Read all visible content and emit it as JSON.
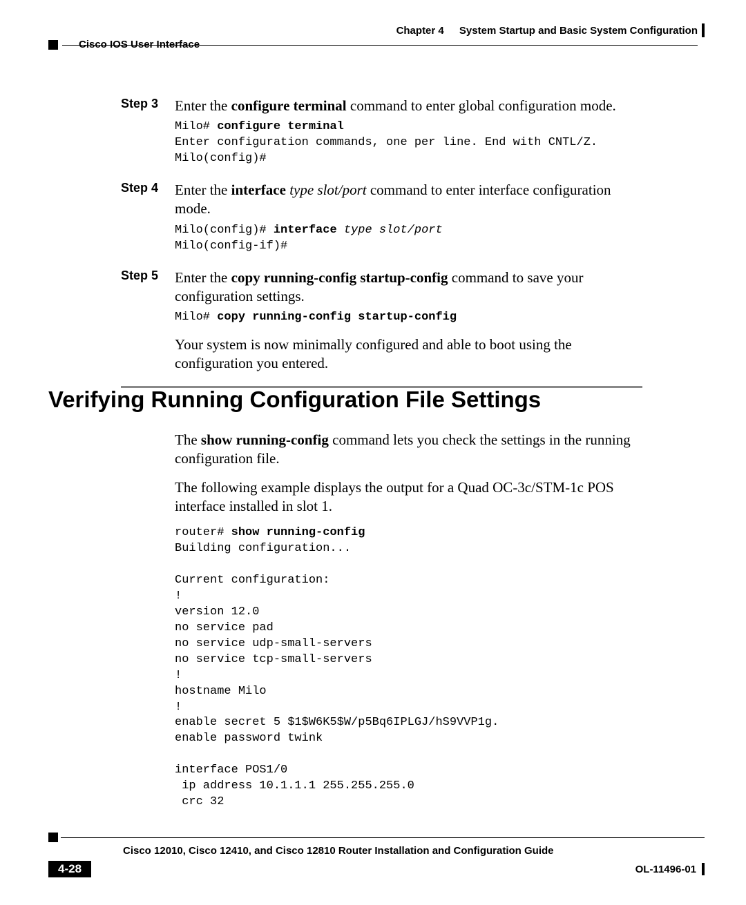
{
  "header": {
    "chapter_label": "Chapter 4",
    "chapter_title": "System Startup and Basic System Configuration",
    "subheader": "Cisco IOS User Interface"
  },
  "steps": {
    "s3": {
      "label": "Step 3",
      "text_pre": "Enter the ",
      "cmd": "configure terminal",
      "text_post": " command to enter global configuration mode.",
      "code_prompt1": "Milo# ",
      "code_cmd1": "configure terminal",
      "code_line2": "Enter configuration commands, one per line. End with CNTL/Z.",
      "code_line3": "Milo(config)#"
    },
    "s4": {
      "label": "Step 4",
      "text_pre": "Enter the ",
      "cmd": "interface",
      "arg": " type slot/port",
      "text_post": " command to enter interface configuration mode.",
      "code_prompt1": "Milo(config)# ",
      "code_cmd1": "interface",
      "code_arg1": " type slot/port",
      "code_line2": "Milo(config-if)#"
    },
    "s5": {
      "label": "Step 5",
      "text_pre": "Enter the ",
      "cmd": "copy running-config startup-config",
      "text_post": " command to save your configuration settings.",
      "code_prompt1": "Milo# ",
      "code_cmd1": "copy running-config startup-config",
      "closing": "Your system is now minimally configured and able to boot using the configuration you entered."
    }
  },
  "section": {
    "heading": "Verifying Running Configuration File Settings",
    "p1_pre": "The ",
    "p1_cmd": "show running-config",
    "p1_post": " command lets you check the settings in the running configuration file.",
    "p2": "The following example displays the output for a Quad OC-3c/STM-1c POS interface installed in slot 1.",
    "code_prompt": "router# ",
    "code_cmd": "show running-config",
    "code_body": "Building configuration...\n\nCurrent configuration:\n!\nversion 12.0\nno service pad\nno service udp-small-servers\nno service tcp-small-servers\n!\nhostname Milo\n!\nenable secret 5 $1$W6K5$W/p5Bq6IPLGJ/hS9VVP1g.\nenable password twink\n\ninterface POS1/0\n ip address 10.1.1.1 255.255.255.0\n crc 32"
  },
  "footer": {
    "guide_title": "Cisco 12010, Cisco 12410, and Cisco 12810 Router Installation and Configuration Guide",
    "page_number": "4-28",
    "doc_id": "OL-11496-01"
  }
}
